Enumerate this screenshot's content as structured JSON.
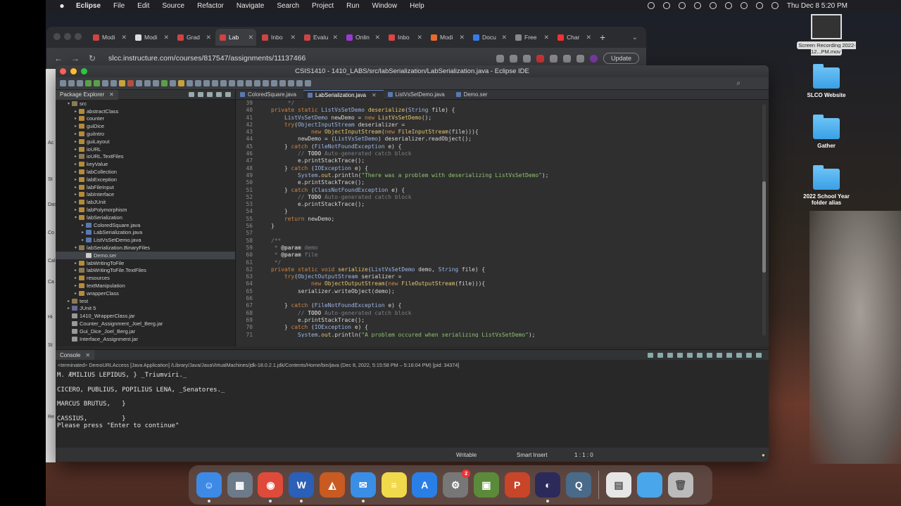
{
  "menubar": {
    "app": "Eclipse",
    "items": [
      "File",
      "Edit",
      "Source",
      "Refactor",
      "Navigate",
      "Search",
      "Project",
      "Run",
      "Window",
      "Help"
    ],
    "datetime": "Thu Dec 8  5:20 PM"
  },
  "browser": {
    "tabs": [
      "Modi",
      "Modi",
      "Grad",
      "Lab",
      "Inbo",
      "Evalu",
      "Onlin",
      "Inbo",
      "Modi",
      "Docu",
      "Free",
      "Char"
    ],
    "active_tab": 3,
    "url": "slcc.instructure.com/courses/817547/assignments/11137466",
    "update_label": "Update"
  },
  "eclipse": {
    "title": "CSIS1410 - 1410_LABS/src/labSerialization/LabSerialization.java - Eclipse IDE",
    "package_explorer": {
      "tab_label": "Package Explorer",
      "items": [
        {
          "label": "src",
          "indent": 1,
          "arrow": "▾",
          "icon": "fold"
        },
        {
          "label": "abstractClass",
          "indent": 2,
          "arrow": "▸",
          "icon": "pkg"
        },
        {
          "label": "counter",
          "indent": 2,
          "arrow": "▸",
          "icon": "pkg"
        },
        {
          "label": "guiDice",
          "indent": 2,
          "arrow": "▸",
          "icon": "pkg"
        },
        {
          "label": "guiIntro",
          "indent": 2,
          "arrow": "▸",
          "icon": "pkg"
        },
        {
          "label": "guiLayout",
          "indent": 2,
          "arrow": "▸",
          "icon": "pkg"
        },
        {
          "label": "ioURL",
          "indent": 2,
          "arrow": "▸",
          "icon": "pkg"
        },
        {
          "label": "ioURL.TextFiles",
          "indent": 2,
          "arrow": "▸",
          "icon": "fold"
        },
        {
          "label": "keyValue",
          "indent": 2,
          "arrow": "▸",
          "icon": "pkg"
        },
        {
          "label": "labCollection",
          "indent": 2,
          "arrow": "▸",
          "icon": "pkg"
        },
        {
          "label": "labException",
          "indent": 2,
          "arrow": "▸",
          "icon": "pkg"
        },
        {
          "label": "labFileInput",
          "indent": 2,
          "arrow": "▸",
          "icon": "pkg"
        },
        {
          "label": "labInterface",
          "indent": 2,
          "arrow": "▸",
          "icon": "pkg"
        },
        {
          "label": "labJUnit",
          "indent": 2,
          "arrow": "▸",
          "icon": "pkg"
        },
        {
          "label": "labPolymorphism",
          "indent": 2,
          "arrow": "▸",
          "icon": "pkg"
        },
        {
          "label": "labSerialization",
          "indent": 2,
          "arrow": "▾",
          "icon": "pkg"
        },
        {
          "label": "ColoredSquare.java",
          "indent": 3,
          "arrow": "▸",
          "icon": "java"
        },
        {
          "label": "LabSerialization.java",
          "indent": 3,
          "arrow": "▸",
          "icon": "java"
        },
        {
          "label": "ListVsSetDemo.java",
          "indent": 3,
          "arrow": "▸",
          "icon": "java"
        },
        {
          "label": "labSerialization.BinaryFiles",
          "indent": 2,
          "arrow": "▾",
          "icon": "fold"
        },
        {
          "label": "Demo.ser",
          "indent": 3,
          "arrow": "",
          "icon": "ser",
          "selected": true
        },
        {
          "label": "labWritingToFile",
          "indent": 2,
          "arrow": "▸",
          "icon": "pkg"
        },
        {
          "label": "labWritingToFile.TextFiles",
          "indent": 2,
          "arrow": "▸",
          "icon": "fold"
        },
        {
          "label": "resources",
          "indent": 2,
          "arrow": "▸",
          "icon": "pkg"
        },
        {
          "label": "textManipulation",
          "indent": 2,
          "arrow": "▸",
          "icon": "pkg"
        },
        {
          "label": "wrapperClass",
          "indent": 2,
          "arrow": "▸",
          "icon": "pkg"
        },
        {
          "label": "test",
          "indent": 1,
          "arrow": "▸",
          "icon": "fold"
        },
        {
          "label": "JUnit 5",
          "indent": 1,
          "arrow": "▸",
          "icon": "lib"
        },
        {
          "label": "1410_WrapperClass.jar",
          "indent": 1,
          "arrow": "",
          "icon": "jar"
        },
        {
          "label": "Counter_Assignment_Joel_Berg.jar",
          "indent": 1,
          "arrow": "",
          "icon": "jar"
        },
        {
          "label": "Gui_Dice_Joel_Berg.jar",
          "indent": 1,
          "arrow": "",
          "icon": "jar"
        },
        {
          "label": "Interface_Assignment.jar",
          "indent": 1,
          "arrow": "",
          "icon": "jar"
        }
      ]
    },
    "editor_tabs": [
      "ColoredSquare.java",
      "LabSerialization.java",
      "ListVsSetDemo.java",
      "Demo.ser"
    ],
    "active_editor_tab": 1,
    "line_numbers": [
      "39",
      "40",
      "41",
      "42",
      "43",
      "44",
      "45",
      "46",
      "47",
      "48",
      "49",
      "50",
      "51",
      "52",
      "53",
      "54",
      "55",
      "56",
      "57",
      "58",
      "59",
      "60",
      "61",
      "62",
      "63",
      "64",
      "65",
      "66",
      "67",
      "68",
      "69",
      "70",
      "71"
    ],
    "console": {
      "tab_label": "Console",
      "terminated": "<terminated> DemoURLAccess [Java Application] /Library/Java/JavaVirtualMachines/jdk-18.0.2.1.jdk/Contents/Home/bin/java  (Dec 8, 2022, 5:15:58 PM – 5:16:04 PM) [pid: 34374]",
      "output": [
        "M. ÆMILIUS LEPIDUS, } _Triumviri._",
        "",
        "CICERO, PUBLIUS, POPILIUS LENA, _Senatores._",
        "",
        "MARCUS BRUTUS,   }",
        "",
        "CASSIUS,         }",
        "Please press \"Enter to continue\""
      ]
    },
    "status": {
      "writable": "Writable",
      "insert": "Smart Insert",
      "position": "1 : 1 : 0"
    }
  },
  "desktop_icons": [
    {
      "label": "Screen Recording 2022-12...PM.mov",
      "type": "recording"
    },
    {
      "label": "SLCO Website",
      "type": "folder"
    },
    {
      "label": "Gather",
      "type": "folder"
    },
    {
      "label": "2022 School Year folder alias",
      "type": "folder"
    }
  ],
  "left_strip_text": [
    "Ac",
    "St",
    "Das",
    "Co",
    "Cal",
    "Ca",
    "Hi",
    "St",
    "Re"
  ],
  "dock": {
    "apps": [
      {
        "name": "finder-icon",
        "color": "#3d8ae6",
        "glyph": "☺"
      },
      {
        "name": "launchpad-icon",
        "color": "#6c7a8a",
        "glyph": "▦"
      },
      {
        "name": "chrome-icon",
        "color": "#e04a3a",
        "glyph": "◉"
      },
      {
        "name": "word-icon",
        "color": "#2b5fb8",
        "glyph": "W"
      },
      {
        "name": "matlab-icon",
        "color": "#c85a22",
        "glyph": "◭"
      },
      {
        "name": "mail-icon",
        "color": "#3a8ee6",
        "glyph": "✉"
      },
      {
        "name": "notes-icon",
        "color": "#f0d94a",
        "glyph": "≡"
      },
      {
        "name": "app-store-icon",
        "color": "#2a7fe6",
        "glyph": "A"
      },
      {
        "name": "system-preferences-icon",
        "color": "#777",
        "glyph": "⚙",
        "badge": "2"
      },
      {
        "name": "minecraft-icon",
        "color": "#5b8a3a",
        "glyph": "▣"
      },
      {
        "name": "powerpoint-icon",
        "color": "#c8452a",
        "glyph": "P"
      },
      {
        "name": "eclipse-icon",
        "color": "#2c2a5a",
        "glyph": "◐"
      },
      {
        "name": "quicktime-icon",
        "color": "#4a6a8a",
        "glyph": "Q"
      }
    ],
    "right": [
      {
        "name": "document-icon",
        "color": "#e6e6e6",
        "glyph": "▤"
      },
      {
        "name": "downloads-folder-icon",
        "color": "#4aa6ea",
        "glyph": ""
      },
      {
        "name": "trash-icon",
        "color": "#bbb",
        "glyph": "🗑"
      }
    ]
  }
}
